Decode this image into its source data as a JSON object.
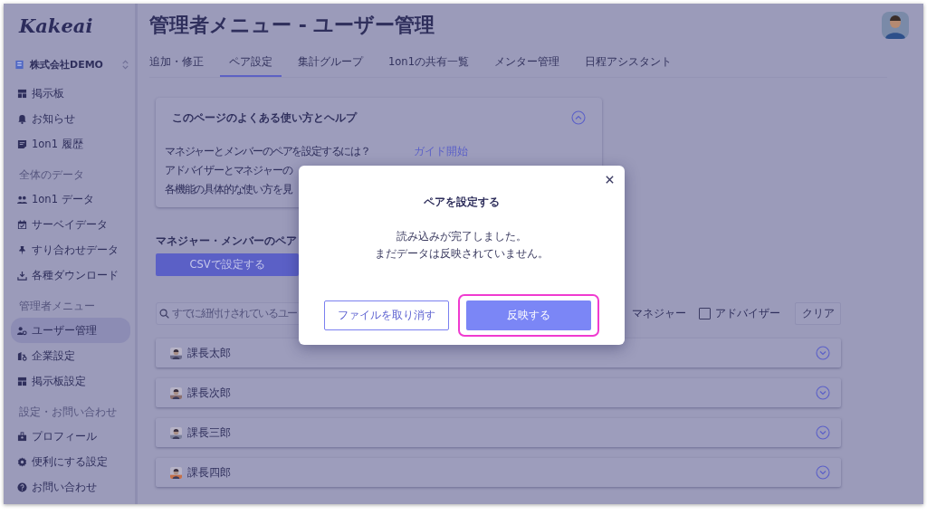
{
  "sidebar": {
    "logo": "Kakeai",
    "company": "株式会社DEMO",
    "sections": [
      {
        "items": [
          {
            "label": "掲示板",
            "selected": false
          },
          {
            "label": "お知らせ",
            "selected": false
          },
          {
            "label": "1on1 履歴",
            "selected": false
          }
        ]
      },
      {
        "heading": "全体のデータ",
        "items": [
          {
            "label": "1on1 データ",
            "selected": false
          },
          {
            "label": "サーベイデータ",
            "selected": false
          },
          {
            "label": "すり合わせデータ",
            "selected": false
          },
          {
            "label": "各種ダウンロード",
            "selected": false
          }
        ]
      },
      {
        "heading": "管理者メニュー",
        "items": [
          {
            "label": "ユーザー管理",
            "selected": true
          },
          {
            "label": "企業設定",
            "selected": false
          },
          {
            "label": "掲示板設定",
            "selected": false
          }
        ]
      },
      {
        "heading": "設定・お問い合わせ",
        "items": [
          {
            "label": "プロフィール",
            "selected": false
          },
          {
            "label": "便利にする設定",
            "selected": false
          },
          {
            "label": "お問い合わせ",
            "selected": false
          }
        ]
      }
    ]
  },
  "page_title": "管理者メニュー - ユーザー管理",
  "tabs": [
    {
      "label": "追加・修正",
      "selected": false
    },
    {
      "label": "ペア設定",
      "selected": true
    },
    {
      "label": "集計グループ",
      "selected": false
    },
    {
      "label": "1on1の共有一覧",
      "selected": false
    },
    {
      "label": "メンター管理",
      "selected": false
    },
    {
      "label": "日程アシスタント",
      "selected": false
    }
  ],
  "help": {
    "title": "このページのよくある使い方とヘルプ",
    "expanded": true,
    "lines": [
      {
        "text": "マネジャーとメンバーのペアを設定するには？",
        "link": "ガイド開始"
      },
      {
        "text": "アドバイザーとマネジャーの"
      },
      {
        "text": "各機能の具体的な使い方を見"
      }
    ]
  },
  "pair_section": {
    "heading": "マネジャー・メンバーのペア",
    "csv_button": "CSVで設定する",
    "search_placeholder": "すでに紐付けされているユー",
    "filters": [
      {
        "label": "マネジャー"
      },
      {
        "label": "アドバイザー",
        "checked": false
      }
    ],
    "clear_button": "クリア",
    "rows": [
      {
        "name": "課長太郎",
        "expanded": false
      },
      {
        "name": "課長次郎",
        "expanded": false
      },
      {
        "name": "課長三郎",
        "expanded": false
      },
      {
        "name": "課長四郎",
        "expanded": false
      }
    ]
  },
  "dialog": {
    "title": "ペアを設定する",
    "messages": [
      "読み込みが完了しました。",
      "まだデータは反映されていません。"
    ],
    "buttons": [
      {
        "label": "ファイルを取り消す",
        "kind": "secondary",
        "highlighted": false
      },
      {
        "label": "反映する",
        "kind": "primary",
        "highlighted": true
      }
    ]
  }
}
